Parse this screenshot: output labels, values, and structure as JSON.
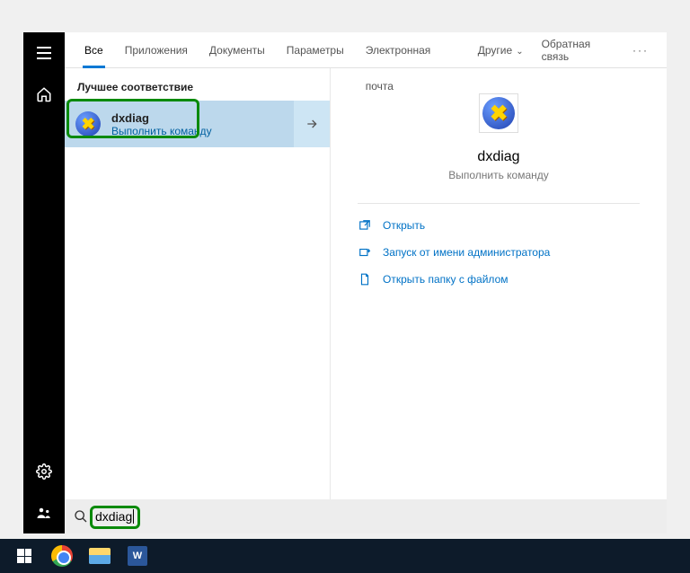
{
  "tabs": {
    "all": "Все",
    "apps": "Приложения",
    "docs": "Документы",
    "params": "Параметры",
    "email": "Электронная почта",
    "other": "Другие",
    "feedback": "Обратная связь"
  },
  "results": {
    "section": "Лучшее соответствие",
    "item": {
      "title": "dxdiag",
      "subtitle": "Выполнить команду"
    }
  },
  "detail": {
    "title": "dxdiag",
    "subtitle": "Выполнить команду",
    "actions": {
      "open": "Открыть",
      "admin": "Запуск от имени администратора",
      "folder": "Открыть папку с файлом"
    }
  },
  "search": {
    "query": "dxdiag"
  },
  "taskbar": {
    "word_label": "W"
  }
}
